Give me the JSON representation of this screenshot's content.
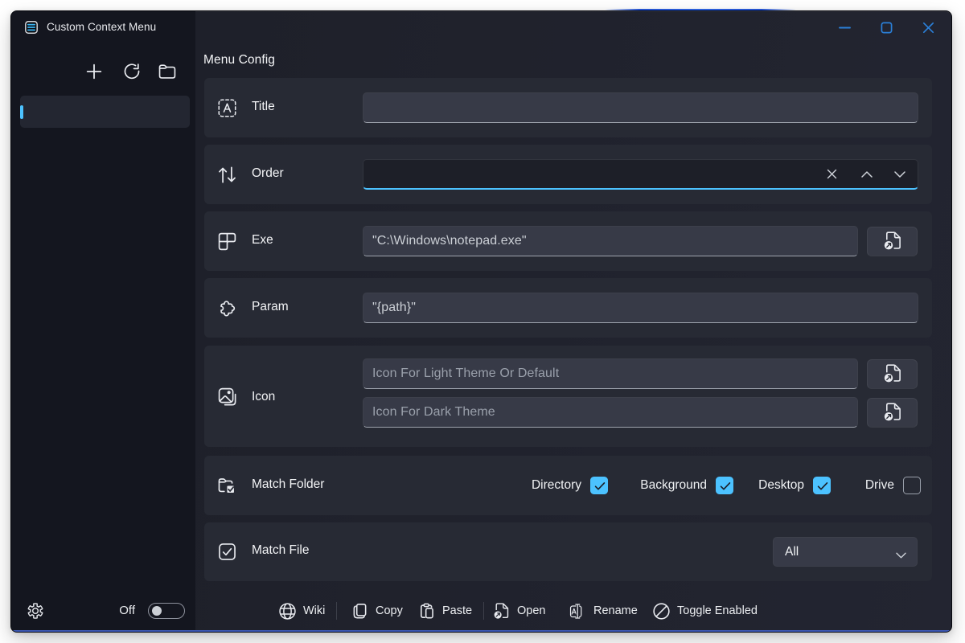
{
  "colors": {
    "page_bg": "#ffffff",
    "main_bg": "#1d1f28",
    "sidebar_bg": "#14161f",
    "card_bg": "#272a34",
    "input_bg": "#373a47",
    "accent": "#4cc2ff",
    "window_control": "#2b80d9",
    "bottom_stripe": "#3d59b5",
    "top_stripe": "#2254d0"
  },
  "titlebar": {
    "title": "Custom Context Menu",
    "app_icon": "menu-list-icon",
    "controls": [
      {
        "name": "minimize",
        "icon": "minimize-icon"
      },
      {
        "name": "maximize",
        "icon": "maximize-icon"
      },
      {
        "name": "close",
        "icon": "close-icon"
      }
    ]
  },
  "sidebar": {
    "toolbar": [
      {
        "name": "add",
        "icon": "add-icon"
      },
      {
        "name": "refresh",
        "icon": "refresh-icon"
      },
      {
        "name": "open-folder",
        "icon": "open-folder-icon"
      }
    ],
    "items": [
      {
        "label": "",
        "selected": true
      }
    ],
    "footer": {
      "settings_icon": "gear-icon",
      "toggle_label": "Off",
      "toggle_on": false
    }
  },
  "main": {
    "heading": "Menu Config",
    "rows": [
      {
        "label": "Title",
        "icon": "rename-box-icon",
        "value": "",
        "placeholder": ""
      },
      {
        "label": "Order",
        "icon": "sort-arrows-icon",
        "value": "",
        "focused": true
      },
      {
        "label": "Exe",
        "icon": "app-window-icon",
        "value": "\"C:\\Windows\\notepad.exe\""
      },
      {
        "label": "Param",
        "icon": "puzzle-icon",
        "value": "\"{path}\""
      },
      {
        "label": "Icon",
        "icon": "image-icon",
        "light_placeholder": "Icon For Light Theme Or Default",
        "dark_placeholder": "Icon For Dark Theme"
      },
      {
        "label": "Match Folder",
        "icon": "folder-check-icon",
        "checkboxes": [
          {
            "label": "Directory",
            "checked": true
          },
          {
            "label": "Background",
            "checked": true
          },
          {
            "label": "Desktop",
            "checked": true
          },
          {
            "label": "Drive",
            "checked": false
          }
        ]
      },
      {
        "label": "Match File",
        "icon": "checkbox-icon",
        "dropdown": "All"
      }
    ],
    "toolbar": [
      {
        "label": "Wiki",
        "icon": "globe-icon"
      },
      {
        "label": "Copy",
        "icon": "copy-icon"
      },
      {
        "label": "Paste",
        "icon": "paste-icon"
      },
      {
        "label": "Open",
        "icon": "open-file-icon"
      },
      {
        "label": "Rename",
        "icon": "rename-icon"
      },
      {
        "label": "Toggle Enabled",
        "icon": "block-icon"
      }
    ]
  }
}
